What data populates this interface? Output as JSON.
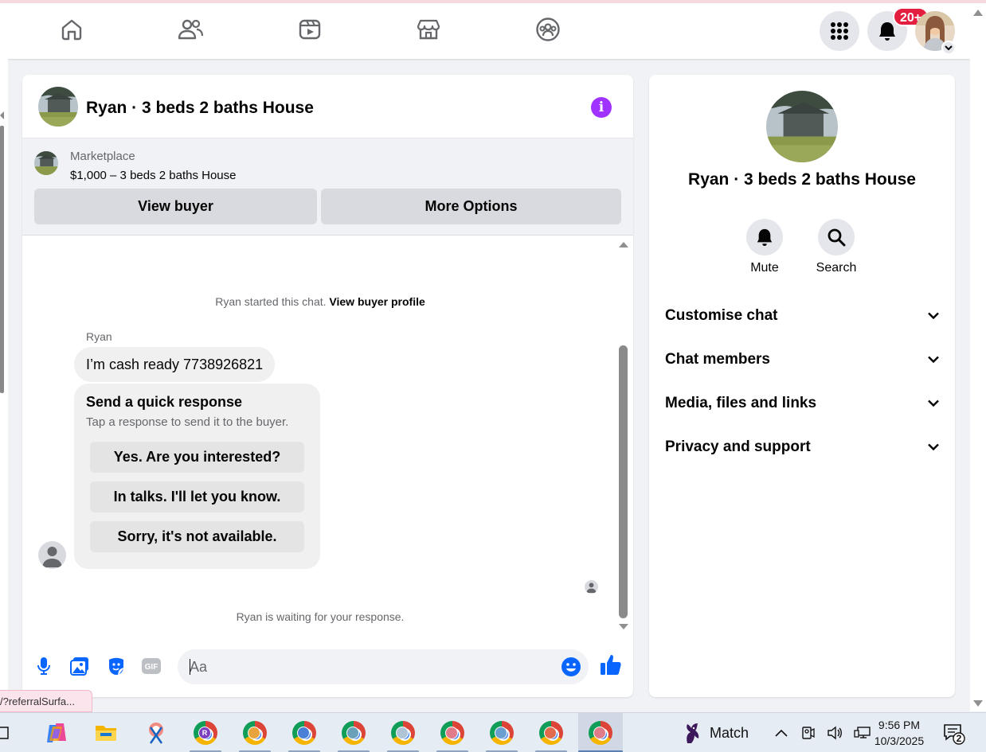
{
  "topnav": {
    "items": [
      "home-icon",
      "friends-icon",
      "video-icon",
      "marketplace-icon",
      "groups-icon"
    ],
    "menu_icon": "grid-menu-icon",
    "notifications_icon": "bell-icon",
    "notifications_badge": "20+",
    "accent": "#1877f2"
  },
  "chat": {
    "title": "Ryan · 3 beds 2 baths House",
    "info_icon": "info-icon",
    "marketplace": {
      "label": "Marketplace",
      "listing": "$1,000 – 3 beds 2 baths House",
      "view_buyer": "View buyer",
      "more_options": "More Options"
    },
    "started_text": "Ryan started this chat.",
    "view_profile": "View buyer profile",
    "sender": "Ryan",
    "message": "I’m cash ready 7738926821",
    "quick_response": {
      "title": "Send a quick response",
      "subtitle": "Tap a response to send it to the buyer.",
      "options": [
        "Yes. Are you interested?",
        "In talks. I'll let you know.",
        "Sorry, it's not available."
      ]
    },
    "waiting_text": "Ryan is waiting for your response.",
    "composer": {
      "placeholder": "Aa",
      "icons": [
        "microphone-icon",
        "photo-icon",
        "sticker-icon",
        "gif-icon",
        "emoji-icon",
        "thumbs-up-icon"
      ]
    }
  },
  "info_panel": {
    "name": "Ryan · 3 beds 2 baths House",
    "actions": [
      {
        "label": "Mute",
        "icon": "bell-icon"
      },
      {
        "label": "Search",
        "icon": "search-icon"
      }
    ],
    "sections": [
      "Customise chat",
      "Chat members",
      "Media, files and links",
      "Privacy and support"
    ]
  },
  "status_url": "/?referralSurfa...",
  "taskbar": {
    "match_label": "Match",
    "time": "9:56 PM",
    "date": "10/3/2025",
    "notifications_count": "2",
    "profile_badges": [
      "R",
      "",
      "",
      "",
      "",
      "",
      "",
      "",
      ""
    ],
    "profile_badge_colors": [
      "#7b3fbf",
      "#e8a33d",
      "#4a7fd6",
      "#6aa0b8",
      "#b0c4d8",
      "#e07b8a",
      "#6a9fd0",
      "#e06b4d",
      "#e07b8a"
    ]
  }
}
